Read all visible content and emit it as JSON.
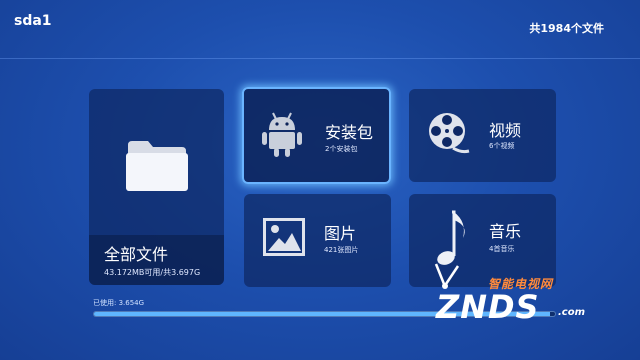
{
  "header": {
    "device_name": "sda1",
    "file_count": "共1984个文件"
  },
  "tiles": {
    "all_files": {
      "title": "全部文件",
      "subtitle": "43.172MB可用/共3.697G",
      "icon": "folder-icon"
    },
    "apk": {
      "title": "安装包",
      "subtitle": "2个安装包",
      "icon": "android-icon",
      "focused": true
    },
    "video": {
      "title": "视频",
      "subtitle": "6个视频",
      "icon": "film-reel-icon"
    },
    "picture": {
      "title": "图片",
      "subtitle": "421张图片",
      "icon": "picture-icon"
    },
    "music": {
      "title": "音乐",
      "subtitle": "4首音乐",
      "icon": "music-note-icon"
    }
  },
  "storage": {
    "used_label": "已使用: 3.654G",
    "used_fraction": 0.9884
  },
  "watermark": {
    "cn": "智能电视网",
    "en": "ZNDS",
    "suffix": ".com"
  },
  "colors": {
    "focus_border": "#6ab4ff",
    "progress_fill": "#5fb6ff",
    "watermark_accent": "#ff8a3c"
  }
}
